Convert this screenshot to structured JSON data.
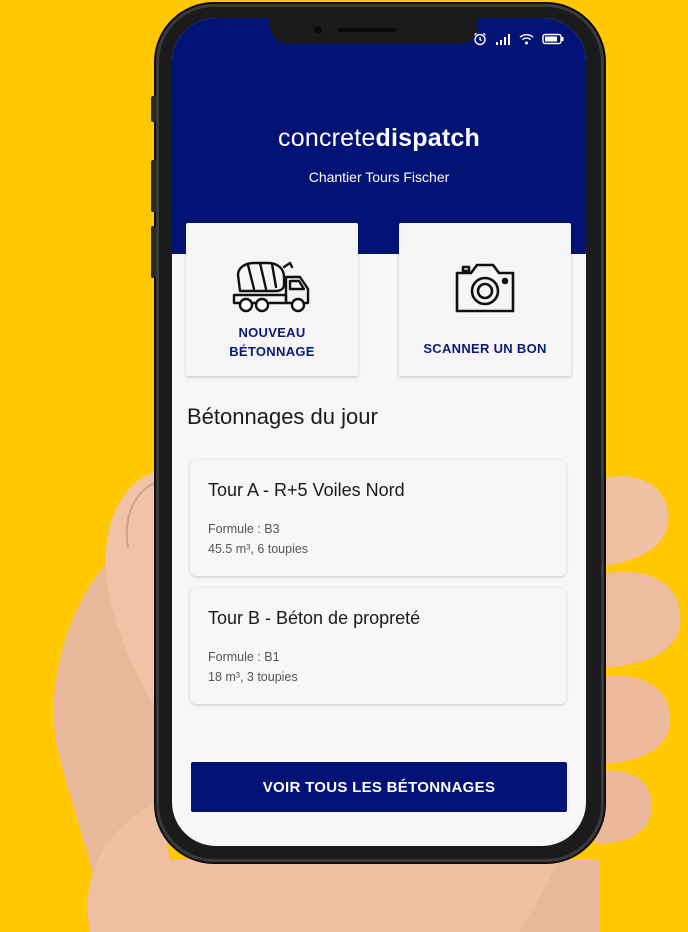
{
  "colors": {
    "background": "#FFC800",
    "brand_navy": "#021375",
    "accent_text": "#0B1A7A"
  },
  "status_bar": {
    "icons": [
      "alarm-icon",
      "signal-icon",
      "wifi-icon",
      "battery-icon"
    ]
  },
  "header": {
    "brand_light": "concrete",
    "brand_bold": "dispatch",
    "site_name": "Chantier Tours Fischer"
  },
  "actions": {
    "new_pour": {
      "line1": "NOUVEAU",
      "line2": "BÉTONNAGE",
      "icon": "concrete-mixer-truck-icon"
    },
    "scan": {
      "label": "SCANNER UN BON",
      "icon": "camera-icon"
    }
  },
  "section_title": "Bétonnages du jour",
  "pours": [
    {
      "name": "Tour A - R+5 Voiles Nord",
      "formula": "Formule : B3",
      "detail": "45.5 m³, 6 toupies"
    },
    {
      "name": "Tour B - Béton de propreté",
      "formula": "Formule : B1",
      "detail": "18 m³, 3 toupies"
    }
  ],
  "see_all_label": "VOIR TOUS LES BÉTONNAGES"
}
